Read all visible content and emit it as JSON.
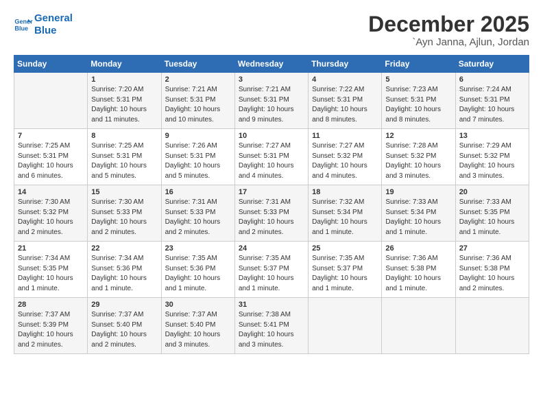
{
  "logo": {
    "line1": "General",
    "line2": "Blue"
  },
  "title": "December 2025",
  "location": "`Ayn Janna, Ajlun, Jordan",
  "headers": [
    "Sunday",
    "Monday",
    "Tuesday",
    "Wednesday",
    "Thursday",
    "Friday",
    "Saturday"
  ],
  "weeks": [
    [
      {
        "day": "",
        "info": ""
      },
      {
        "day": "1",
        "info": "Sunrise: 7:20 AM\nSunset: 5:31 PM\nDaylight: 10 hours\nand 11 minutes."
      },
      {
        "day": "2",
        "info": "Sunrise: 7:21 AM\nSunset: 5:31 PM\nDaylight: 10 hours\nand 10 minutes."
      },
      {
        "day": "3",
        "info": "Sunrise: 7:21 AM\nSunset: 5:31 PM\nDaylight: 10 hours\nand 9 minutes."
      },
      {
        "day": "4",
        "info": "Sunrise: 7:22 AM\nSunset: 5:31 PM\nDaylight: 10 hours\nand 8 minutes."
      },
      {
        "day": "5",
        "info": "Sunrise: 7:23 AM\nSunset: 5:31 PM\nDaylight: 10 hours\nand 8 minutes."
      },
      {
        "day": "6",
        "info": "Sunrise: 7:24 AM\nSunset: 5:31 PM\nDaylight: 10 hours\nand 7 minutes."
      }
    ],
    [
      {
        "day": "7",
        "info": "Sunrise: 7:25 AM\nSunset: 5:31 PM\nDaylight: 10 hours\nand 6 minutes."
      },
      {
        "day": "8",
        "info": "Sunrise: 7:25 AM\nSunset: 5:31 PM\nDaylight: 10 hours\nand 5 minutes."
      },
      {
        "day": "9",
        "info": "Sunrise: 7:26 AM\nSunset: 5:31 PM\nDaylight: 10 hours\nand 5 minutes."
      },
      {
        "day": "10",
        "info": "Sunrise: 7:27 AM\nSunset: 5:31 PM\nDaylight: 10 hours\nand 4 minutes."
      },
      {
        "day": "11",
        "info": "Sunrise: 7:27 AM\nSunset: 5:32 PM\nDaylight: 10 hours\nand 4 minutes."
      },
      {
        "day": "12",
        "info": "Sunrise: 7:28 AM\nSunset: 5:32 PM\nDaylight: 10 hours\nand 3 minutes."
      },
      {
        "day": "13",
        "info": "Sunrise: 7:29 AM\nSunset: 5:32 PM\nDaylight: 10 hours\nand 3 minutes."
      }
    ],
    [
      {
        "day": "14",
        "info": "Sunrise: 7:30 AM\nSunset: 5:32 PM\nDaylight: 10 hours\nand 2 minutes."
      },
      {
        "day": "15",
        "info": "Sunrise: 7:30 AM\nSunset: 5:33 PM\nDaylight: 10 hours\nand 2 minutes."
      },
      {
        "day": "16",
        "info": "Sunrise: 7:31 AM\nSunset: 5:33 PM\nDaylight: 10 hours\nand 2 minutes."
      },
      {
        "day": "17",
        "info": "Sunrise: 7:31 AM\nSunset: 5:33 PM\nDaylight: 10 hours\nand 2 minutes."
      },
      {
        "day": "18",
        "info": "Sunrise: 7:32 AM\nSunset: 5:34 PM\nDaylight: 10 hours\nand 1 minute."
      },
      {
        "day": "19",
        "info": "Sunrise: 7:33 AM\nSunset: 5:34 PM\nDaylight: 10 hours\nand 1 minute."
      },
      {
        "day": "20",
        "info": "Sunrise: 7:33 AM\nSunset: 5:35 PM\nDaylight: 10 hours\nand 1 minute."
      }
    ],
    [
      {
        "day": "21",
        "info": "Sunrise: 7:34 AM\nSunset: 5:35 PM\nDaylight: 10 hours\nand 1 minute."
      },
      {
        "day": "22",
        "info": "Sunrise: 7:34 AM\nSunset: 5:36 PM\nDaylight: 10 hours\nand 1 minute."
      },
      {
        "day": "23",
        "info": "Sunrise: 7:35 AM\nSunset: 5:36 PM\nDaylight: 10 hours\nand 1 minute."
      },
      {
        "day": "24",
        "info": "Sunrise: 7:35 AM\nSunset: 5:37 PM\nDaylight: 10 hours\nand 1 minute."
      },
      {
        "day": "25",
        "info": "Sunrise: 7:35 AM\nSunset: 5:37 PM\nDaylight: 10 hours\nand 1 minute."
      },
      {
        "day": "26",
        "info": "Sunrise: 7:36 AM\nSunset: 5:38 PM\nDaylight: 10 hours\nand 1 minute."
      },
      {
        "day": "27",
        "info": "Sunrise: 7:36 AM\nSunset: 5:38 PM\nDaylight: 10 hours\nand 2 minutes."
      }
    ],
    [
      {
        "day": "28",
        "info": "Sunrise: 7:37 AM\nSunset: 5:39 PM\nDaylight: 10 hours\nand 2 minutes."
      },
      {
        "day": "29",
        "info": "Sunrise: 7:37 AM\nSunset: 5:40 PM\nDaylight: 10 hours\nand 2 minutes."
      },
      {
        "day": "30",
        "info": "Sunrise: 7:37 AM\nSunset: 5:40 PM\nDaylight: 10 hours\nand 3 minutes."
      },
      {
        "day": "31",
        "info": "Sunrise: 7:38 AM\nSunset: 5:41 PM\nDaylight: 10 hours\nand 3 minutes."
      },
      {
        "day": "",
        "info": ""
      },
      {
        "day": "",
        "info": ""
      },
      {
        "day": "",
        "info": ""
      }
    ]
  ]
}
